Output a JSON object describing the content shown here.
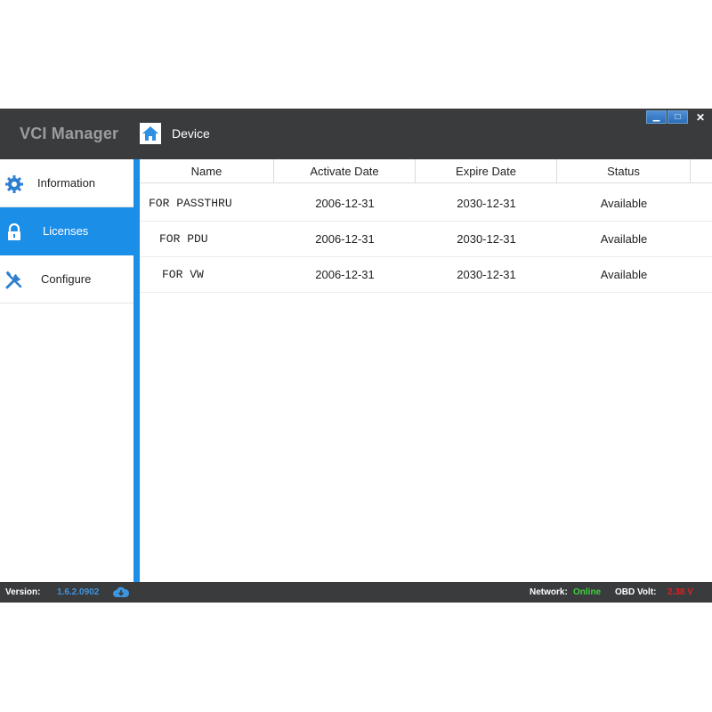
{
  "app": {
    "title": "VCI Manager",
    "breadcrumb": "Device",
    "window_controls": {
      "minimize": "▁",
      "maximize": "□",
      "close": "✕"
    }
  },
  "sidebar": {
    "items": [
      {
        "label": "Information",
        "icon": "gear-icon",
        "active": false
      },
      {
        "label": "Licenses",
        "icon": "lock-icon",
        "active": true
      },
      {
        "label": "Configure",
        "icon": "tools-icon",
        "active": false
      }
    ]
  },
  "table": {
    "columns": [
      "Name",
      "Activate Date",
      "Expire Date",
      "Status"
    ],
    "rows": [
      {
        "name": "FOR PASSTHRU",
        "activate": "2006-12-31",
        "expire": "2030-12-31",
        "status": "Available"
      },
      {
        "name": "FOR PDU",
        "activate": "2006-12-31",
        "expire": "2030-12-31",
        "status": "Available"
      },
      {
        "name": "FOR VW",
        "activate": "2006-12-31",
        "expire": "2030-12-31",
        "status": "Available"
      }
    ]
  },
  "statusbar": {
    "version_label": "Version:",
    "version_value": "1.6.2.0902",
    "network_label": "Network:",
    "network_value": "Online",
    "obd_label": "OBD Volt:",
    "obd_value": "2.38 V"
  },
  "colors": {
    "accent": "#1b8ee8",
    "titlebar": "#3a3b3d",
    "version": "#3d95e0",
    "online": "#3fd13f",
    "obd_volt": "#e02020"
  }
}
